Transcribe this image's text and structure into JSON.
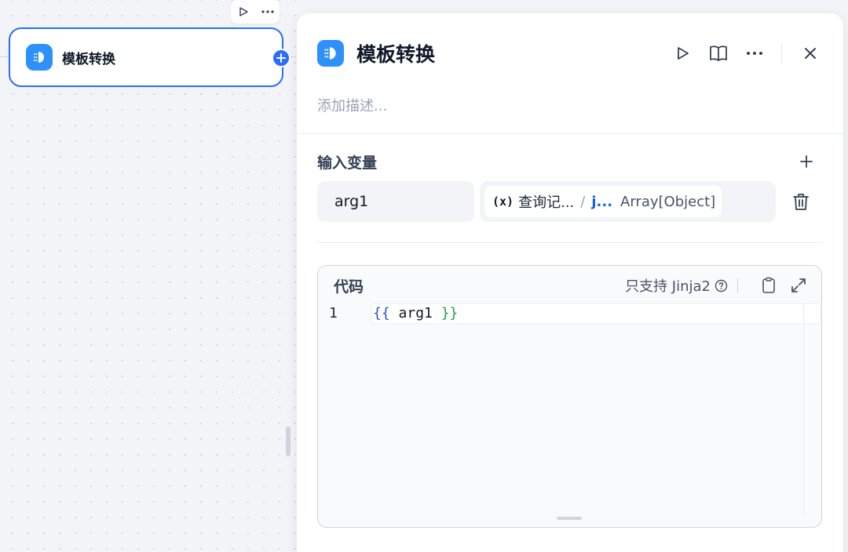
{
  "canvas": {
    "node": {
      "title": "模板转换",
      "icon": "template-transform-icon"
    },
    "node_toolbar": {
      "icons": [
        "play-icon",
        "more-icon"
      ]
    }
  },
  "panel": {
    "title": "模板转换",
    "description_placeholder": "添加描述...",
    "header_icons": [
      "play-icon",
      "book-icon",
      "more-icon",
      "close-icon"
    ],
    "input_section": {
      "title": "输入变量",
      "variables": [
        {
          "name": "arg1",
          "ref_icon": "(x)",
          "ref_node": "查询记...",
          "ref_separator": "/",
          "ref_var": "j...",
          "ref_type": "Array[Object]"
        }
      ]
    },
    "code_section": {
      "label": "代码",
      "note": "只支持 Jinja2",
      "lines": [
        {
          "number": "1",
          "open": "{{",
          "content": " arg1 ",
          "close": "}}"
        }
      ]
    }
  },
  "colors": {
    "accent": "#296dff",
    "icon_bg": "#2e90fa"
  }
}
